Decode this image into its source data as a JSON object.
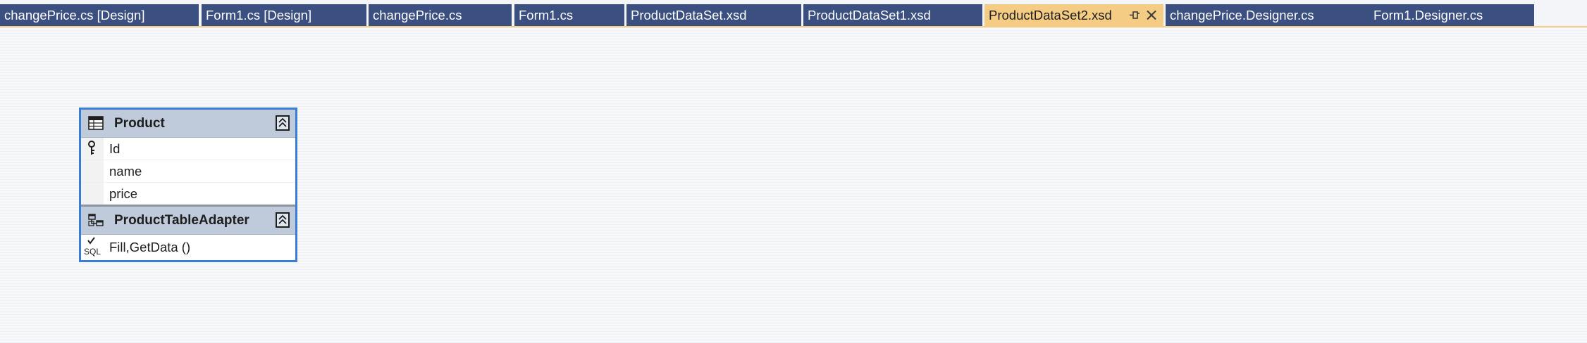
{
  "tabs": [
    {
      "label": "changePrice.cs [Design]"
    },
    {
      "label": "Form1.cs [Design]"
    },
    {
      "label": "changePrice.cs"
    },
    {
      "label": "Form1.cs"
    },
    {
      "label": "ProductDataSet.xsd"
    },
    {
      "label": "ProductDataSet1.xsd"
    },
    {
      "label": "ProductDataSet2.xsd",
      "active": true,
      "pin_icon": "pin-icon",
      "close_icon": "close-icon"
    },
    {
      "label": "changePrice.Designer.cs"
    },
    {
      "label": "Form1.Designer.cs"
    }
  ],
  "colors": {
    "tab_background": "#3b4f81",
    "active_tab_background": "#f5cc84",
    "table_border": "#3a7dd4",
    "table_header": "#bfcbdb"
  },
  "designer": {
    "table": {
      "name": "Product",
      "icon": "datatable-icon",
      "collapse_icon": "collapse-chevrons-icon",
      "columns": [
        {
          "name": "Id",
          "primary_key": true,
          "icon": "key-icon"
        },
        {
          "name": "name"
        },
        {
          "name": "price"
        }
      ]
    },
    "adapter": {
      "name": "ProductTableAdapter",
      "icon": "tableadapter-icon",
      "collapse_icon": "collapse-chevrons-icon",
      "query_icon": "sql-query-icon",
      "query_icon_text": "SQL",
      "methods": "Fill,GetData ()"
    }
  }
}
